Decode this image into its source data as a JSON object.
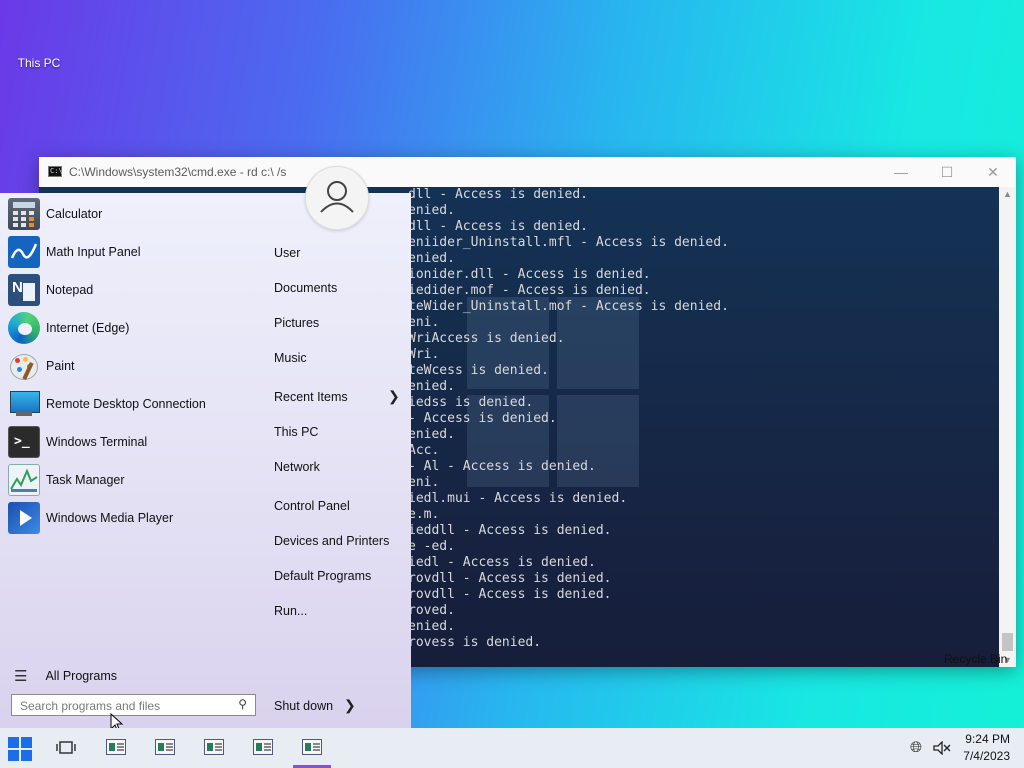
{
  "desktop": {
    "icons": [
      {
        "label": "This PC"
      }
    ],
    "recycle_label": "Recycle Bin"
  },
  "cmd": {
    "title": "C:\\Windows\\system32\\cmd.exe - rd  c:\\ /s",
    "lines": [
      "dll - Access is denied.",
      "enied.",
      "dll - Access is denied.",
      "eniider_Uninstall.mfl - Access is denied.",
      "enied.",
      "ionider.dll - Access is denied.",
      "iedider.mof - Access is denied.",
      "teWider_Uninstall.mof - Access is denied.",
      "eni.",
      "WriAccess is denied.",
      "Wri.",
      "teWcess is denied.",
      "enied.",
      "iedss is denied.",
      "- Access is denied.",
      "enied.",
      "Acc.",
      "- Al - Access is denied.",
      "eni.",
      "iedl.mui - Access is denied.",
      "e.m.",
      "ieddll - Access is denied.",
      "e -ed.",
      "iedl - Access is denied.",
      "rovdll - Access is denied.",
      "rovdll - Access is denied.",
      "roved.",
      "enied.",
      "rovess is denied."
    ]
  },
  "start": {
    "programs": [
      {
        "label": "Calculator",
        "icon": "calculator-icon"
      },
      {
        "label": "Math Input Panel",
        "icon": "math-input-icon"
      },
      {
        "label": "Notepad",
        "icon": "notepad-icon"
      },
      {
        "label": "Internet (Edge)",
        "icon": "edge-icon"
      },
      {
        "label": "Paint",
        "icon": "paint-icon"
      },
      {
        "label": "Remote Desktop Connection",
        "icon": "remote-desktop-icon"
      },
      {
        "label": "Windows Terminal",
        "icon": "terminal-icon"
      },
      {
        "label": "Task Manager",
        "icon": "task-manager-icon"
      },
      {
        "label": "Windows Media Player",
        "icon": "media-player-icon"
      }
    ],
    "right_items": [
      {
        "label": "User"
      },
      {
        "label": "Documents"
      },
      {
        "label": "Pictures"
      },
      {
        "label": "Music"
      },
      {
        "label": "Recent Items"
      },
      {
        "label": "This PC"
      },
      {
        "label": "Network"
      },
      {
        "label": "Control Panel"
      },
      {
        "label": "Devices and Printers"
      },
      {
        "label": "Default Programs"
      },
      {
        "label": "Run..."
      }
    ],
    "all_programs": "All Programs",
    "search_placeholder": "Search programs and files",
    "shutdown": "Shut down"
  },
  "taskbar": {
    "time": "9:24 PM",
    "date": "7/4/2023",
    "accent": "#1b6ee8"
  }
}
